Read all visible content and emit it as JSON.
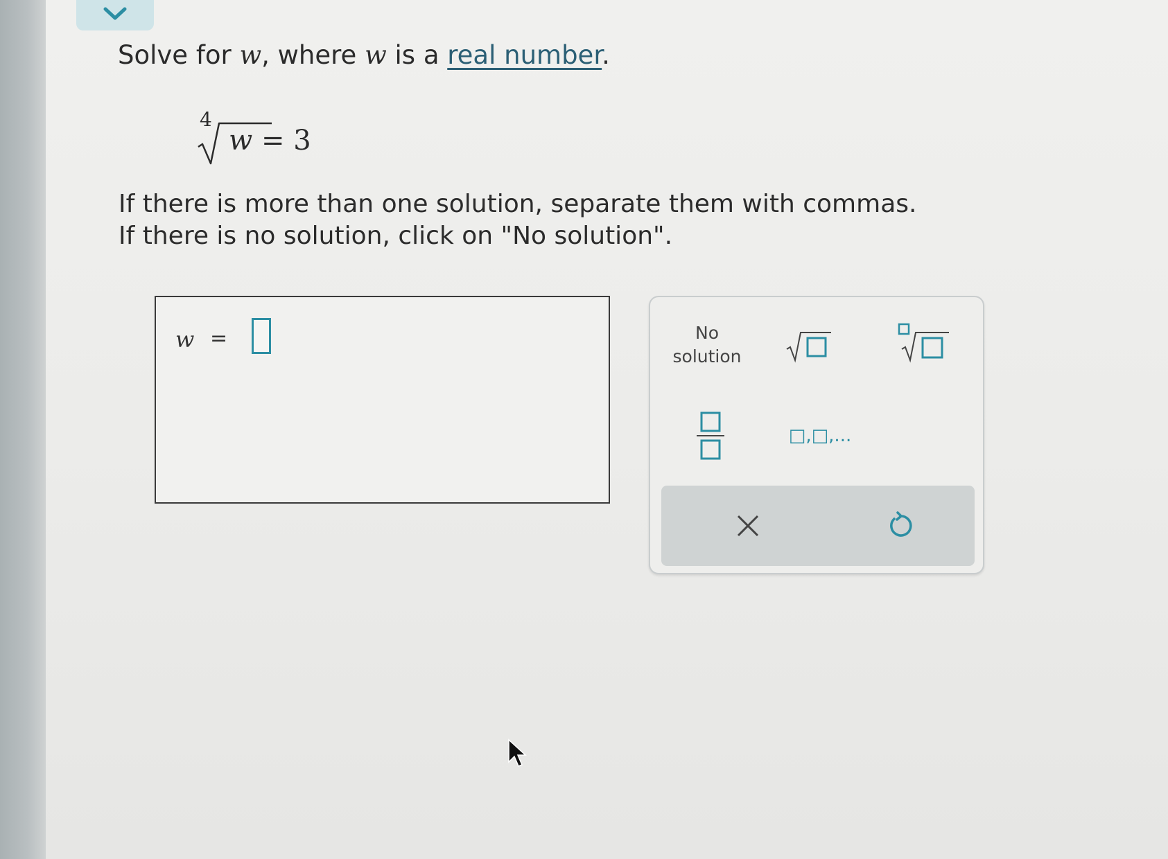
{
  "prompt": {
    "prefix": "Solve for ",
    "var1": "w",
    "middle": ", where ",
    "var2": "w",
    "middle2": " is a ",
    "link_text": "real number",
    "suffix": "."
  },
  "equation": {
    "index": "4",
    "radicand": "w",
    "equals": " = 3"
  },
  "instructions": {
    "line1": "If there is more than one solution, separate them with commas.",
    "line2": "If there is no solution, click on \"No solution\"."
  },
  "answer": {
    "variable": "w",
    "equals": "=",
    "value": ""
  },
  "keypad": {
    "no_solution_line1": "No",
    "no_solution_line2": "solution",
    "list_key_label": "□,□,...",
    "keys": [
      "sqrt-icon",
      "nth-root-icon",
      "fraction-icon",
      "list-icon",
      "clear-icon",
      "undo-icon"
    ],
    "accent_color": "#2c8ea3"
  }
}
